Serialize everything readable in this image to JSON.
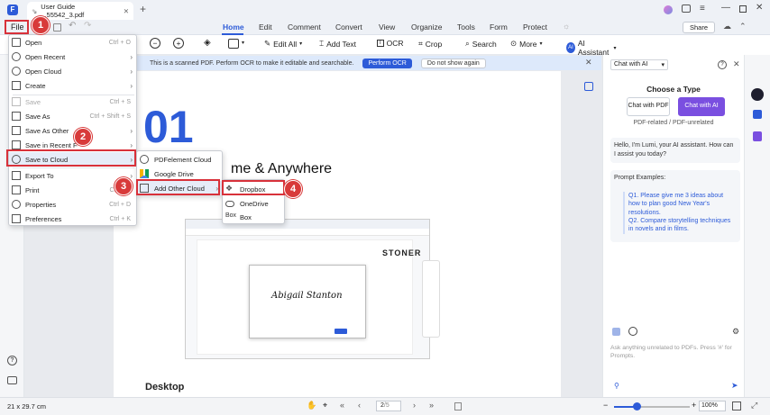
{
  "titlebar": {
    "tab_title": "User Guide ...55542_3.pdf",
    "new_tab": "+"
  },
  "menubar": {
    "file": "File",
    "tabs": [
      "Home",
      "Edit",
      "Comment",
      "Convert",
      "View",
      "Organize",
      "Tools",
      "Form",
      "Protect"
    ],
    "share": "Share"
  },
  "toolbar": {
    "edit_all": "Edit All",
    "add_text": "Add Text",
    "ocr": "OCR",
    "crop": "Crop",
    "search": "Search",
    "more": "More"
  },
  "ai_assistant": "AI Assistant",
  "notice": {
    "text": "This is a scanned PDF. Perform OCR to make it editable and searchable.",
    "perform": "Perform OCR",
    "dismiss": "Do not show again"
  },
  "file_menu": [
    {
      "label": "Open",
      "shortcut": "Ctrl + O"
    },
    {
      "label": "Open Recent",
      "arrow": "›"
    },
    {
      "label": "Open Cloud",
      "arrow": "›"
    },
    {
      "label": "Create",
      "arrow": "›"
    },
    {
      "label": "Save",
      "shortcut": "Ctrl + S"
    },
    {
      "label": "Save As",
      "shortcut": "Ctrl + Shift + S"
    },
    {
      "label": "Save As Other",
      "arrow": "›"
    },
    {
      "label": "Save in Recent Folder",
      "arrow": "›"
    },
    {
      "label": "Save to Cloud",
      "arrow": "›"
    },
    {
      "label": "Export To",
      "arrow": "›"
    },
    {
      "label": "Print",
      "shortcut": "Ctrl + P"
    },
    {
      "label": "Properties",
      "shortcut": "Ctrl + D"
    },
    {
      "label": "Preferences",
      "shortcut": "Ctrl + K"
    }
  ],
  "cloud_menu": [
    "PDFelement Cloud",
    "Google Drive",
    "Add Other Cloud"
  ],
  "other_cloud_menu": [
    "Dropbox",
    "OneDrive",
    "Box"
  ],
  "box_icon": "Box",
  "steps": [
    "1",
    "2",
    "3",
    "4"
  ],
  "doc": {
    "big_number": "01",
    "heading": "me & Anywhere",
    "section": "Desktop",
    "stoner": "STONER",
    "signature": "Abigail Stanton"
  },
  "right_panel": {
    "dropdown": "Chat with AI",
    "choose": "Choose a Type",
    "option1": "Chat with PDF",
    "option2": "Chat with AI",
    "option_caption": "PDF-related / PDF-unrelated",
    "greeting": "Hello, I'm Lumi, your AI assistant. How can I assist you today?",
    "prompt_title": "Prompt Examples:",
    "prompt1": "Q1. Please give me 3 ideas about how to plan good New Year's resolutions.",
    "prompt2": "Q2. Compare storytelling techniques in novels and in films.",
    "input_placeholder": "Ask anything unrelated to PDFs. Press '#' for Prompts."
  },
  "status": {
    "size": "21 x 29.7 cm",
    "page": "2",
    "total": "/5",
    "zoom": "100%",
    "zoom_level": 0.3
  },
  "colors": {
    "accent": "#2d5bd8",
    "step_red": "#d83a3a",
    "ai_purple": "#7a4fe0"
  }
}
